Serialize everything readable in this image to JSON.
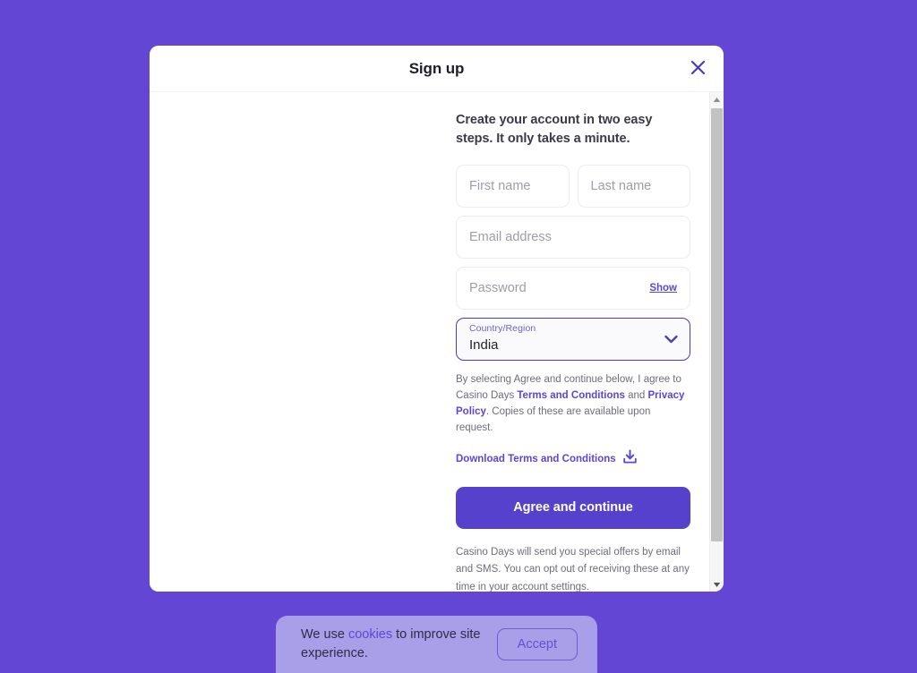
{
  "page": {
    "background_color": "#6347d4"
  },
  "modal": {
    "title": "Sign up",
    "close_icon": "close-icon",
    "intro": "Create your account in two easy steps. It only takes a minute.",
    "fields": {
      "first_name": {
        "placeholder": "First name",
        "value": ""
      },
      "last_name": {
        "placeholder": "Last name",
        "value": ""
      },
      "email": {
        "placeholder": "Email address",
        "value": ""
      },
      "password": {
        "placeholder": "Password",
        "value": "",
        "show_label": "Show"
      }
    },
    "country": {
      "label": "Country/Region",
      "value": "India",
      "chevron_icon": "chevron-down-icon"
    },
    "legal": {
      "part1": "By selecting Agree and continue below, I agree to Casino Days ",
      "terms_link": "Terms and Conditions",
      "part2": " and ",
      "privacy_link": "Privacy Policy",
      "part3": ". Copies of these are available upon request."
    },
    "download": {
      "label": "Download Terms and Conditions",
      "icon": "download-icon"
    },
    "submit_label": "Agree and continue",
    "offers_text": "Casino Days will send you special offers by email and SMS. You can opt out of receiving these at any time in your account settings.",
    "scrollbar": {
      "up_icon": "scroll-up-arrow-icon",
      "down_icon": "scroll-down-arrow-icon"
    },
    "accent_color": "#5541cc",
    "link_color": "#5b47d6"
  },
  "cookie_banner": {
    "text_before": "We use ",
    "link": "cookies",
    "text_after": " to improve site experience.",
    "accept_label": "Accept",
    "background_color": "#a99ee8"
  }
}
